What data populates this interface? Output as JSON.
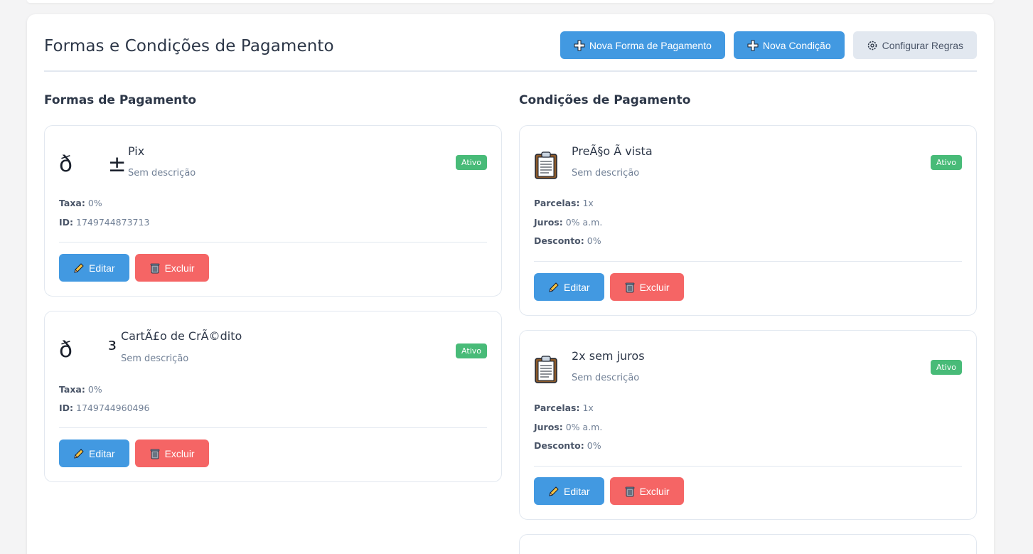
{
  "header": {
    "title": "Formas e Condições de Pagamento",
    "new_payment_method_label": "Nova Forma de Pagamento",
    "new_condition_label": "Nova Condição",
    "configure_rules_label": "Configurar Regras"
  },
  "payment_methods": {
    "title": "Formas de Pagamento",
    "items": [
      {
        "icon_text": "ð±",
        "name": "Pix",
        "description": "Sem descrição",
        "status": "Ativo",
        "fee_label": "Taxa:",
        "fee_value": "0%",
        "id_label": "ID:",
        "id_value": "1749744873713",
        "edit_label": "Editar",
        "delete_label": "Excluir"
      },
      {
        "icon_text": "ð³",
        "name": "CartÃ£o de CrÃ©dito",
        "description": "Sem descrição",
        "status": "Ativo",
        "fee_label": "Taxa:",
        "fee_value": "0%",
        "id_label": "ID:",
        "id_value": "1749744960496",
        "edit_label": "Editar",
        "delete_label": "Excluir"
      }
    ]
  },
  "payment_conditions": {
    "title": "Condições de Pagamento",
    "items": [
      {
        "icon": "clipboard-icon",
        "name": "PreÃ§o Ã  vista",
        "description": "Sem descrição",
        "status": "Ativo",
        "installments_label": "Parcelas:",
        "installments_value": "1x",
        "interest_label": "Juros:",
        "interest_value": "0% a.m.",
        "discount_label": "Desconto:",
        "discount_value": "0%",
        "edit_label": "Editar",
        "delete_label": "Excluir"
      },
      {
        "icon": "clipboard-icon",
        "name": "2x sem juros",
        "description": "Sem descrição",
        "status": "Ativo",
        "installments_label": "Parcelas:",
        "installments_value": "1x",
        "interest_label": "Juros:",
        "interest_value": "0% a.m.",
        "discount_label": "Desconto:",
        "discount_value": "0%",
        "edit_label": "Editar",
        "delete_label": "Excluir"
      }
    ]
  },
  "colors": {
    "primary": "#4299e1",
    "danger": "#f56565",
    "success": "#48bb78",
    "neutral": "#e2e8f0"
  }
}
